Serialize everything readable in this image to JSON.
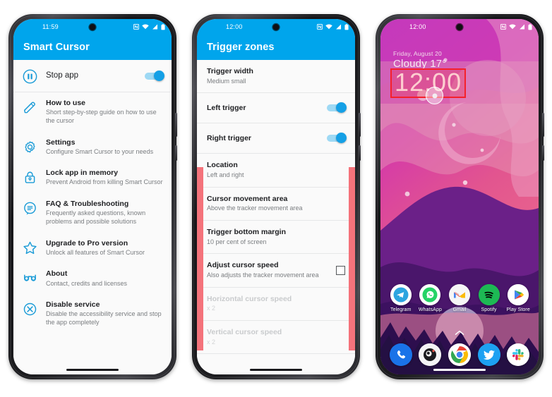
{
  "phone1": {
    "status": {
      "time": "11:59",
      "icons": [
        "nfc-icon",
        "wifi-icon",
        "signal-icon",
        "battery-icon"
      ]
    },
    "appbar": {
      "title": "Smart Cursor"
    },
    "items": [
      {
        "icon": "pause-circle-icon",
        "title": "Stop app",
        "subtitle": "",
        "toggle": true
      },
      {
        "icon": "pencil-icon",
        "title": "How to use",
        "subtitle": "Short step-by-step guide on how to use the cursor"
      },
      {
        "icon": "gear-icon",
        "title": "Settings",
        "subtitle": "Configure Smart Cursor to your needs"
      },
      {
        "icon": "lock-icon",
        "title": "Lock app in memory",
        "subtitle": "Prevent Android from killing Smart Cursor"
      },
      {
        "icon": "chat-faq-icon",
        "title": "FAQ & Troubleshooting",
        "subtitle": "Frequently asked questions, known problems and possible solutions"
      },
      {
        "icon": "star-icon",
        "title": "Upgrade to Pro version",
        "subtitle": "Unlock all features of Smart Cursor"
      },
      {
        "icon": "glasses-icon",
        "title": "About",
        "subtitle": "Contact, credits and licenses"
      },
      {
        "icon": "cross-circle-icon",
        "title": "Disable service",
        "subtitle": "Disable the accessibility service and stop the app completely"
      }
    ]
  },
  "phone2": {
    "status": {
      "time": "12:00"
    },
    "appbar": {
      "title": "Trigger zones"
    },
    "items": [
      {
        "title": "Trigger width",
        "subtitle": "Medium small",
        "control": "none",
        "disabled": false
      },
      {
        "title": "Left trigger",
        "subtitle": "",
        "control": "switch",
        "on": true,
        "disabled": false
      },
      {
        "title": "Right trigger",
        "subtitle": "",
        "control": "switch",
        "on": true,
        "disabled": false
      },
      {
        "title": "Location",
        "subtitle": "Left and right",
        "control": "none",
        "disabled": false
      },
      {
        "title": "Cursor movement area",
        "subtitle": "Above the tracker movement area",
        "control": "none",
        "disabled": false
      },
      {
        "title": "Trigger bottom margin",
        "subtitle": "10 per cent of screen",
        "control": "none",
        "disabled": false
      },
      {
        "title": "Adjust cursor speed",
        "subtitle": "Also adjusts the tracker movement area",
        "control": "checkbox",
        "checked": false,
        "disabled": false
      },
      {
        "title": "Horizontal cursor speed",
        "subtitle": "x 2",
        "control": "none",
        "disabled": true
      },
      {
        "title": "Vertical cursor speed",
        "subtitle": "x 2",
        "control": "none",
        "disabled": true
      }
    ],
    "trigger_zone_color": "#F4737B"
  },
  "phone3": {
    "status": {
      "time": "12:00"
    },
    "lock": {
      "date": "Friday, August 20",
      "weather": "Cloudy 17°",
      "clock": "12:00"
    },
    "highlight_color": "#F5202B",
    "apps": [
      {
        "label": "Telegram",
        "icon": "telegram-icon"
      },
      {
        "label": "WhatsApp",
        "icon": "whatsapp-icon"
      },
      {
        "label": "Gmail",
        "icon": "gmail-icon"
      },
      {
        "label": "Spotify",
        "icon": "spotify-icon"
      },
      {
        "label": "Play Store",
        "icon": "play-store-icon"
      }
    ],
    "dock": [
      {
        "label": "Phone",
        "icon": "phone-icon"
      },
      {
        "label": "Camera",
        "icon": "camera-icon"
      },
      {
        "label": "Chrome",
        "icon": "chrome-icon"
      },
      {
        "label": "Twitter",
        "icon": "twitter-icon"
      },
      {
        "label": "Slack",
        "icon": "slack-icon"
      }
    ]
  },
  "theme": {
    "accent": "#00A5EC",
    "icon_blue": "#1A9BD7",
    "toggle_on": "#14A0E6"
  }
}
